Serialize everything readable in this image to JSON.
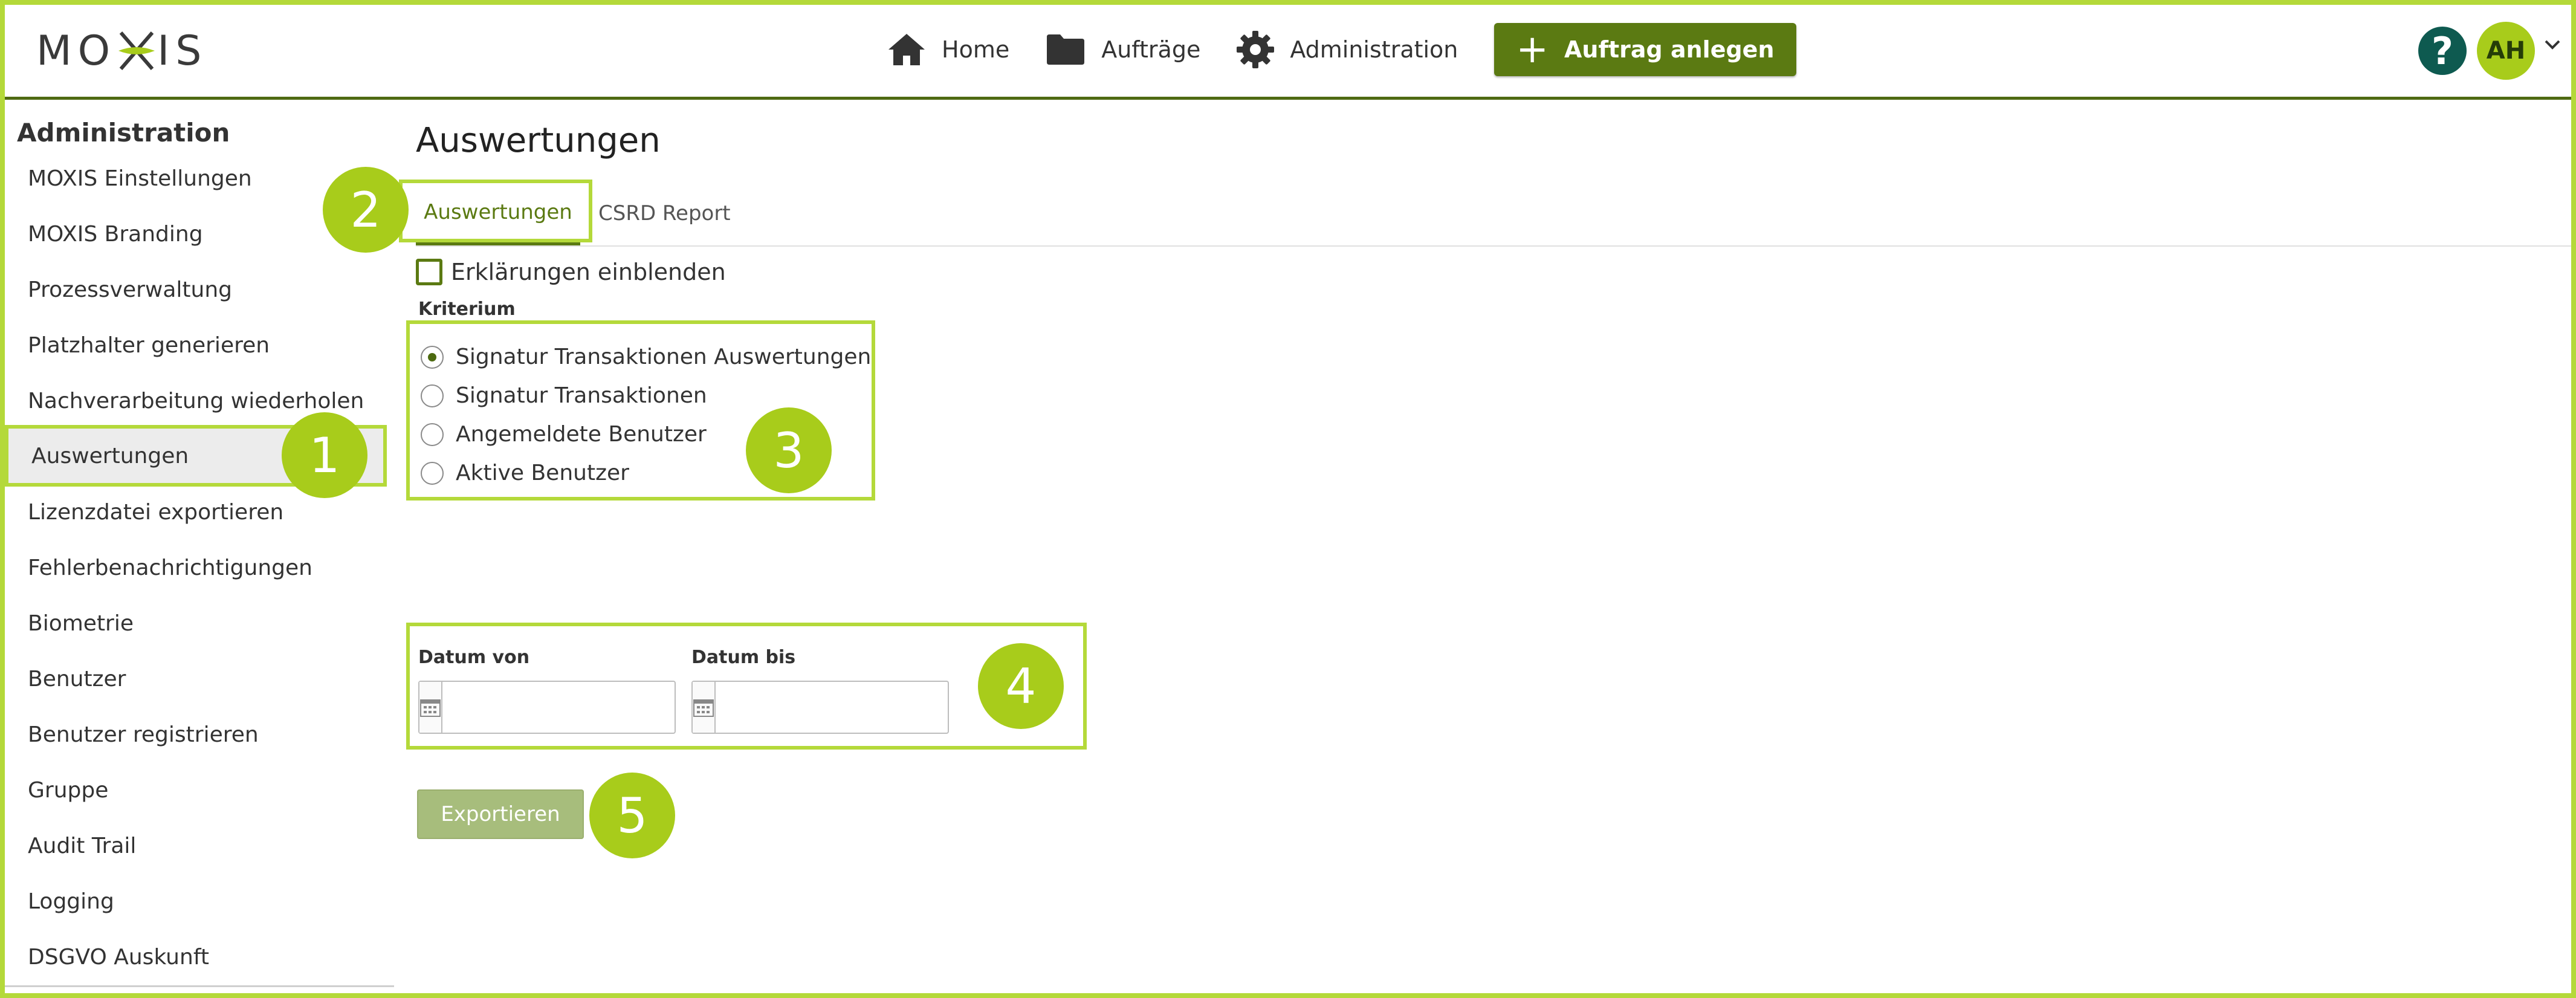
{
  "header": {
    "logo_left": "MO",
    "logo_right": "IS",
    "nav": [
      {
        "label": "Home",
        "icon": "home-icon"
      },
      {
        "label": "Aufträge",
        "icon": "folder-icon"
      },
      {
        "label": "Administration",
        "icon": "gear-icon"
      }
    ],
    "create_label": "Auftrag anlegen",
    "help_label": "?",
    "avatar_initials": "AH"
  },
  "sidebar": {
    "title": "Administration",
    "items": [
      {
        "label": "MOXIS Einstellungen"
      },
      {
        "label": "MOXIS Branding"
      },
      {
        "label": "Prozessverwaltung"
      },
      {
        "label": "Platzhalter generieren"
      },
      {
        "label": "Nachverarbeitung wiederholen"
      },
      {
        "label": "Auswertungen",
        "active": true
      },
      {
        "label": "Lizenzdatei exportieren"
      },
      {
        "label": "Fehlerbenachrichtigungen"
      },
      {
        "label": "Biometrie"
      },
      {
        "label": "Benutzer"
      },
      {
        "label": "Benutzer registrieren"
      },
      {
        "label": "Gruppe"
      },
      {
        "label": "Audit Trail"
      },
      {
        "label": "Logging"
      },
      {
        "label": "DSGVO Auskunft"
      }
    ]
  },
  "main": {
    "title": "Auswertungen",
    "tabs": [
      {
        "label": "Auswertungen",
        "active": true
      },
      {
        "label": "CSRD Report"
      }
    ],
    "show_explanations_label": "Erklärungen einblenden",
    "criterion_label": "Kriterium",
    "criteria": [
      {
        "label": "Signatur Transaktionen Auswertungen",
        "checked": true
      },
      {
        "label": "Signatur Transaktionen"
      },
      {
        "label": "Angemeldete Benutzer"
      },
      {
        "label": "Aktive Benutzer"
      }
    ],
    "date_from_label": "Datum von",
    "date_to_label": "Datum bis",
    "date_from_value": "",
    "date_to_value": "",
    "export_label": "Exportieren"
  },
  "annotations": [
    "1",
    "2",
    "3",
    "4",
    "5"
  ],
  "colors": {
    "accent": "#b4d93a",
    "primary": "#5b7a12",
    "help": "#0e5a50"
  }
}
